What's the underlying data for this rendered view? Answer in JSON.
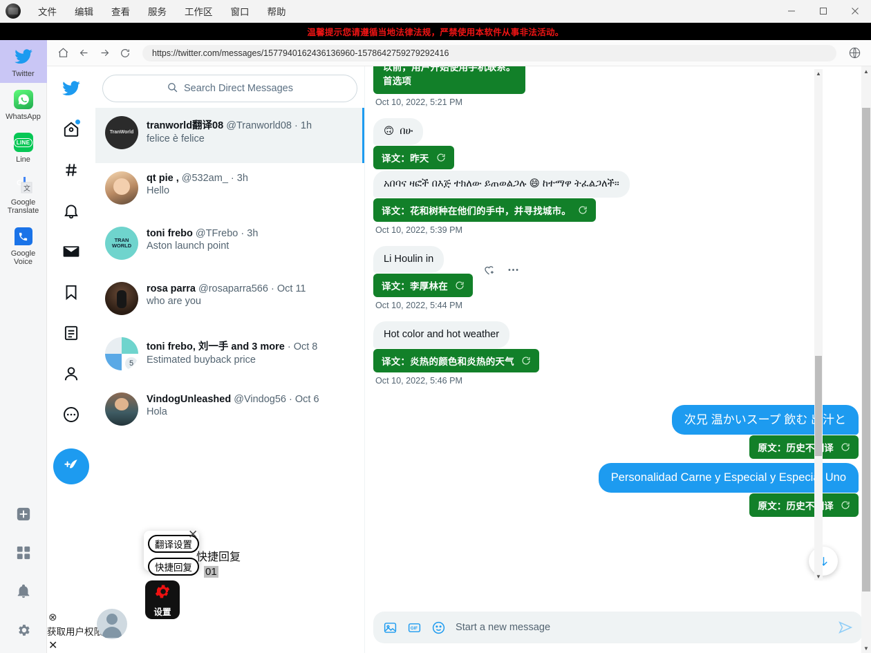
{
  "window": {
    "menus": [
      "文件",
      "编辑",
      "查看",
      "服务",
      "工作区",
      "窗口",
      "帮助"
    ],
    "controls": {
      "minimize": "minimize-icon",
      "maximize": "maximize-icon",
      "close": "close-icon"
    }
  },
  "banner": {
    "text": "温馨提示您请遵循当地法律法规，严禁使用本软件从事非法活动。",
    "color": "#f01414",
    "bg": "#000000"
  },
  "app_rail": {
    "items": [
      {
        "label": "Twitter",
        "icon": "twitter-bird-icon",
        "active": true
      },
      {
        "label": "WhatsApp",
        "icon": "whatsapp-icon",
        "active": false
      },
      {
        "label": "Line",
        "icon": "line-icon",
        "active": false
      },
      {
        "label": "Google Translate",
        "icon": "google-translate-icon",
        "active": false
      },
      {
        "label": "Google Voice",
        "icon": "google-voice-icon",
        "active": false
      }
    ],
    "bottom_icons": [
      "plus-square-icon",
      "grid-icon",
      "bell-icon",
      "gear-icon"
    ]
  },
  "browser": {
    "url": "https://twitter.com/messages/1577940162436136960-1578642759279292416",
    "buttons": [
      "home-icon",
      "back-arrow-icon",
      "forward-arrow-icon",
      "reload-icon"
    ],
    "right_icon": "globe-icon"
  },
  "twitter_nav": [
    "twitter-bird-icon",
    "home-icon",
    "explore-hashtag-icon",
    "notifications-bell-icon",
    "messages-mail-icon",
    "bookmarks-icon",
    "lists-icon",
    "profile-icon",
    "more-icon"
  ],
  "search": {
    "placeholder": "Search Direct Messages",
    "icon": "search-icon"
  },
  "conversations": [
    {
      "name": "tranworld翻译08",
      "handle": "@Tranworld08",
      "time": "1h",
      "snippet": "felice è felice",
      "avatar": "tranworld-avatar",
      "active": true
    },
    {
      "name": "qt pie ,",
      "handle": "@532am_",
      "time": "3h",
      "snippet": "Hello",
      "avatar": "qtpie-avatar",
      "active": false
    },
    {
      "name": "toni frebo",
      "handle": "@TFrebo",
      "time": "3h",
      "snippet": "Aston launch point",
      "avatar": "tranworld-teal-avatar",
      "active": false
    },
    {
      "name": "rosa parra",
      "handle": "@rosaparra566",
      "time": "Oct 11",
      "snippet": "who are you",
      "avatar": "rosaparra-avatar",
      "active": false
    },
    {
      "name": "toni frebo, 刘一手 and 3 more",
      "handle": "",
      "time": "Oct 8",
      "snippet": "Estimated buyback price",
      "avatar": "group-avatar",
      "badge": "5",
      "active": false
    },
    {
      "name": "VindogUnleashed",
      "handle": "@Vindog56",
      "time": "Oct 6",
      "snippet": "Hola",
      "avatar": "vindog-avatar",
      "active": false
    }
  ],
  "messages": [
    {
      "side": "in",
      "kind": "translation_only",
      "text": "以前，用户开始使用手机联系。\n首选项",
      "timestamp": "Oct 10, 2022, 5:21 PM"
    },
    {
      "side": "in",
      "kind": "bubble",
      "emoji": "🙃",
      "text": "በሁ",
      "translation": "译文：昨天",
      "timestamp": ""
    },
    {
      "side": "in",
      "kind": "bubble",
      "text": "አበባና ዛፎች በእጅ ተክለው ይጠወልጋሉ 😄 ከተማዋ ትፈልጋለች።",
      "translation": "译文：花和树种在他们的手中，并寻找城市。",
      "timestamp": "Oct 10, 2022, 5:39 PM"
    },
    {
      "side": "in",
      "kind": "bubble",
      "text": "Li Houlin in",
      "translation": "译文：李厚林在",
      "timestamp": "Oct 10, 2022, 5:44 PM",
      "actions": [
        "like-icon",
        "more-icon"
      ]
    },
    {
      "side": "in",
      "kind": "bubble",
      "text": "Hot color and hot weather",
      "translation": "译文：炎热的颜色和炎热的天气",
      "timestamp": "Oct 10, 2022, 5:46 PM"
    },
    {
      "side": "out",
      "kind": "bubble",
      "text": "次兄 温かいスープ 飲む 出汁と",
      "translation": "原文：历史不翻译",
      "timestamp": ""
    },
    {
      "side": "out",
      "kind": "bubble",
      "text": "Personalidad Carne y Especial y Especial Uno",
      "translation": "原文：历史不翻译",
      "timestamp": ""
    }
  ],
  "composer": {
    "placeholder": "Start a new message",
    "icons": [
      "image-icon",
      "gif-icon",
      "emoji-icon"
    ],
    "send_icon": "send-icon"
  },
  "scroll_fab": {
    "icon": "arrow-down-icon"
  },
  "overlay": {
    "translate_settings": "翻译设置",
    "quick_reply": "快捷回复",
    "close": "✕",
    "quick_reply_label": "快捷回复",
    "quick_reply_number": "01",
    "settings_label": "设置",
    "settings_icon": "red-gear-icon"
  },
  "toast": {
    "icon": "error-circle-icon",
    "text": "获取用户权限失败",
    "close": "✕"
  },
  "colors": {
    "twitter_blue": "#1d9bf0",
    "translate_green": "#128029",
    "bubble_gray": "#eff3f4",
    "banner_red": "#f01414",
    "active_app_bg": "#c9c6f5"
  }
}
